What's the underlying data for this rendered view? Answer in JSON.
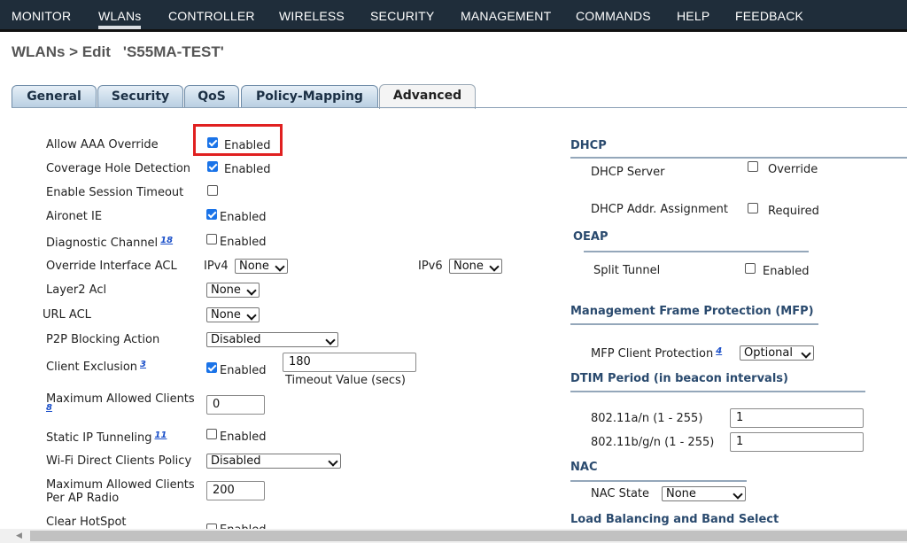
{
  "nav": {
    "items": [
      "MONITOR",
      "WLANs",
      "CONTROLLER",
      "WIRELESS",
      "SECURITY",
      "MANAGEMENT",
      "COMMANDS",
      "HELP",
      "FEEDBACK"
    ],
    "active": "WLANs"
  },
  "page": {
    "breadcrumb": "WLANs > Edit",
    "wlan_name": "'S55MA-TEST'"
  },
  "tabs": [
    "General",
    "Security",
    "QoS",
    "Policy-Mapping",
    "Advanced"
  ],
  "active_tab": "Advanced",
  "left": {
    "allow_aaa_override": {
      "label": "Allow AAA Override",
      "checked": true,
      "option": "Enabled"
    },
    "coverage_hole": {
      "label": "Coverage Hole Detection",
      "checked": true,
      "option": "Enabled"
    },
    "session_timeout": {
      "label": "Enable Session Timeout",
      "checked": false
    },
    "aironet_ie": {
      "label": "Aironet IE",
      "checked": true,
      "option": "Enabled"
    },
    "diagnostic_channel": {
      "label": "Diagnostic Channel",
      "ref": "18",
      "checked": false,
      "option": "Enabled"
    },
    "override_acl": {
      "label": "Override Interface ACL",
      "ipv4_label": "IPv4",
      "ipv4_value": "None",
      "ipv6_label": "IPv6",
      "ipv6_value": "None"
    },
    "layer2_acl": {
      "label": "Layer2 Acl",
      "value": "None"
    },
    "url_acl": {
      "label": "URL ACL",
      "value": "None"
    },
    "p2p": {
      "label": "P2P Blocking Action",
      "value": "Disabled"
    },
    "client_exclusion": {
      "label": "Client Exclusion",
      "ref": "3",
      "checked": true,
      "option": "Enabled",
      "timeout": "180",
      "timeout_label": "Timeout Value (secs)"
    },
    "max_clients": {
      "label": "Maximum Allowed Clients",
      "ref": "8",
      "value": "0"
    },
    "static_ip": {
      "label": "Static IP Tunneling",
      "ref": "11",
      "checked": false,
      "option": "Enabled"
    },
    "wifi_direct": {
      "label": "Wi-Fi Direct Clients Policy",
      "value": "Disabled"
    },
    "max_clients_ap": {
      "label_line1": "Maximum Allowed Clients",
      "label_line2": "Per AP Radio",
      "value": "200"
    },
    "clear_hotspot": {
      "label": "Clear HotSpot",
      "option": "Enabled"
    }
  },
  "right": {
    "dhcp": {
      "title": "DHCP",
      "server_label": "DHCP Server",
      "server_option": "Override",
      "server_checked": false,
      "assign_label": "DHCP Addr. Assignment",
      "assign_option": "Required",
      "assign_checked": false
    },
    "oeap": {
      "title": "OEAP",
      "split_label": "Split Tunnel",
      "split_option": "Enabled",
      "split_checked": false
    },
    "mfp": {
      "title": "Management Frame Protection (MFP)",
      "label": "MFP Client Protection",
      "ref": "4",
      "value": "Optional"
    },
    "dtim": {
      "title": "DTIM Period (in beacon intervals)",
      "a_label": "802.11a/n (1 - 255)",
      "a_value": "1",
      "b_label": "802.11b/g/n (1 - 255)",
      "b_value": "1"
    },
    "nac": {
      "title": "NAC",
      "label": "NAC State",
      "value": "None"
    },
    "lb": {
      "title": "Load Balancing and Band Select"
    }
  },
  "colors": {
    "nav_bg": "#1f2d3a",
    "highlight": "#e02020",
    "section_title": "#2a4a6e"
  }
}
